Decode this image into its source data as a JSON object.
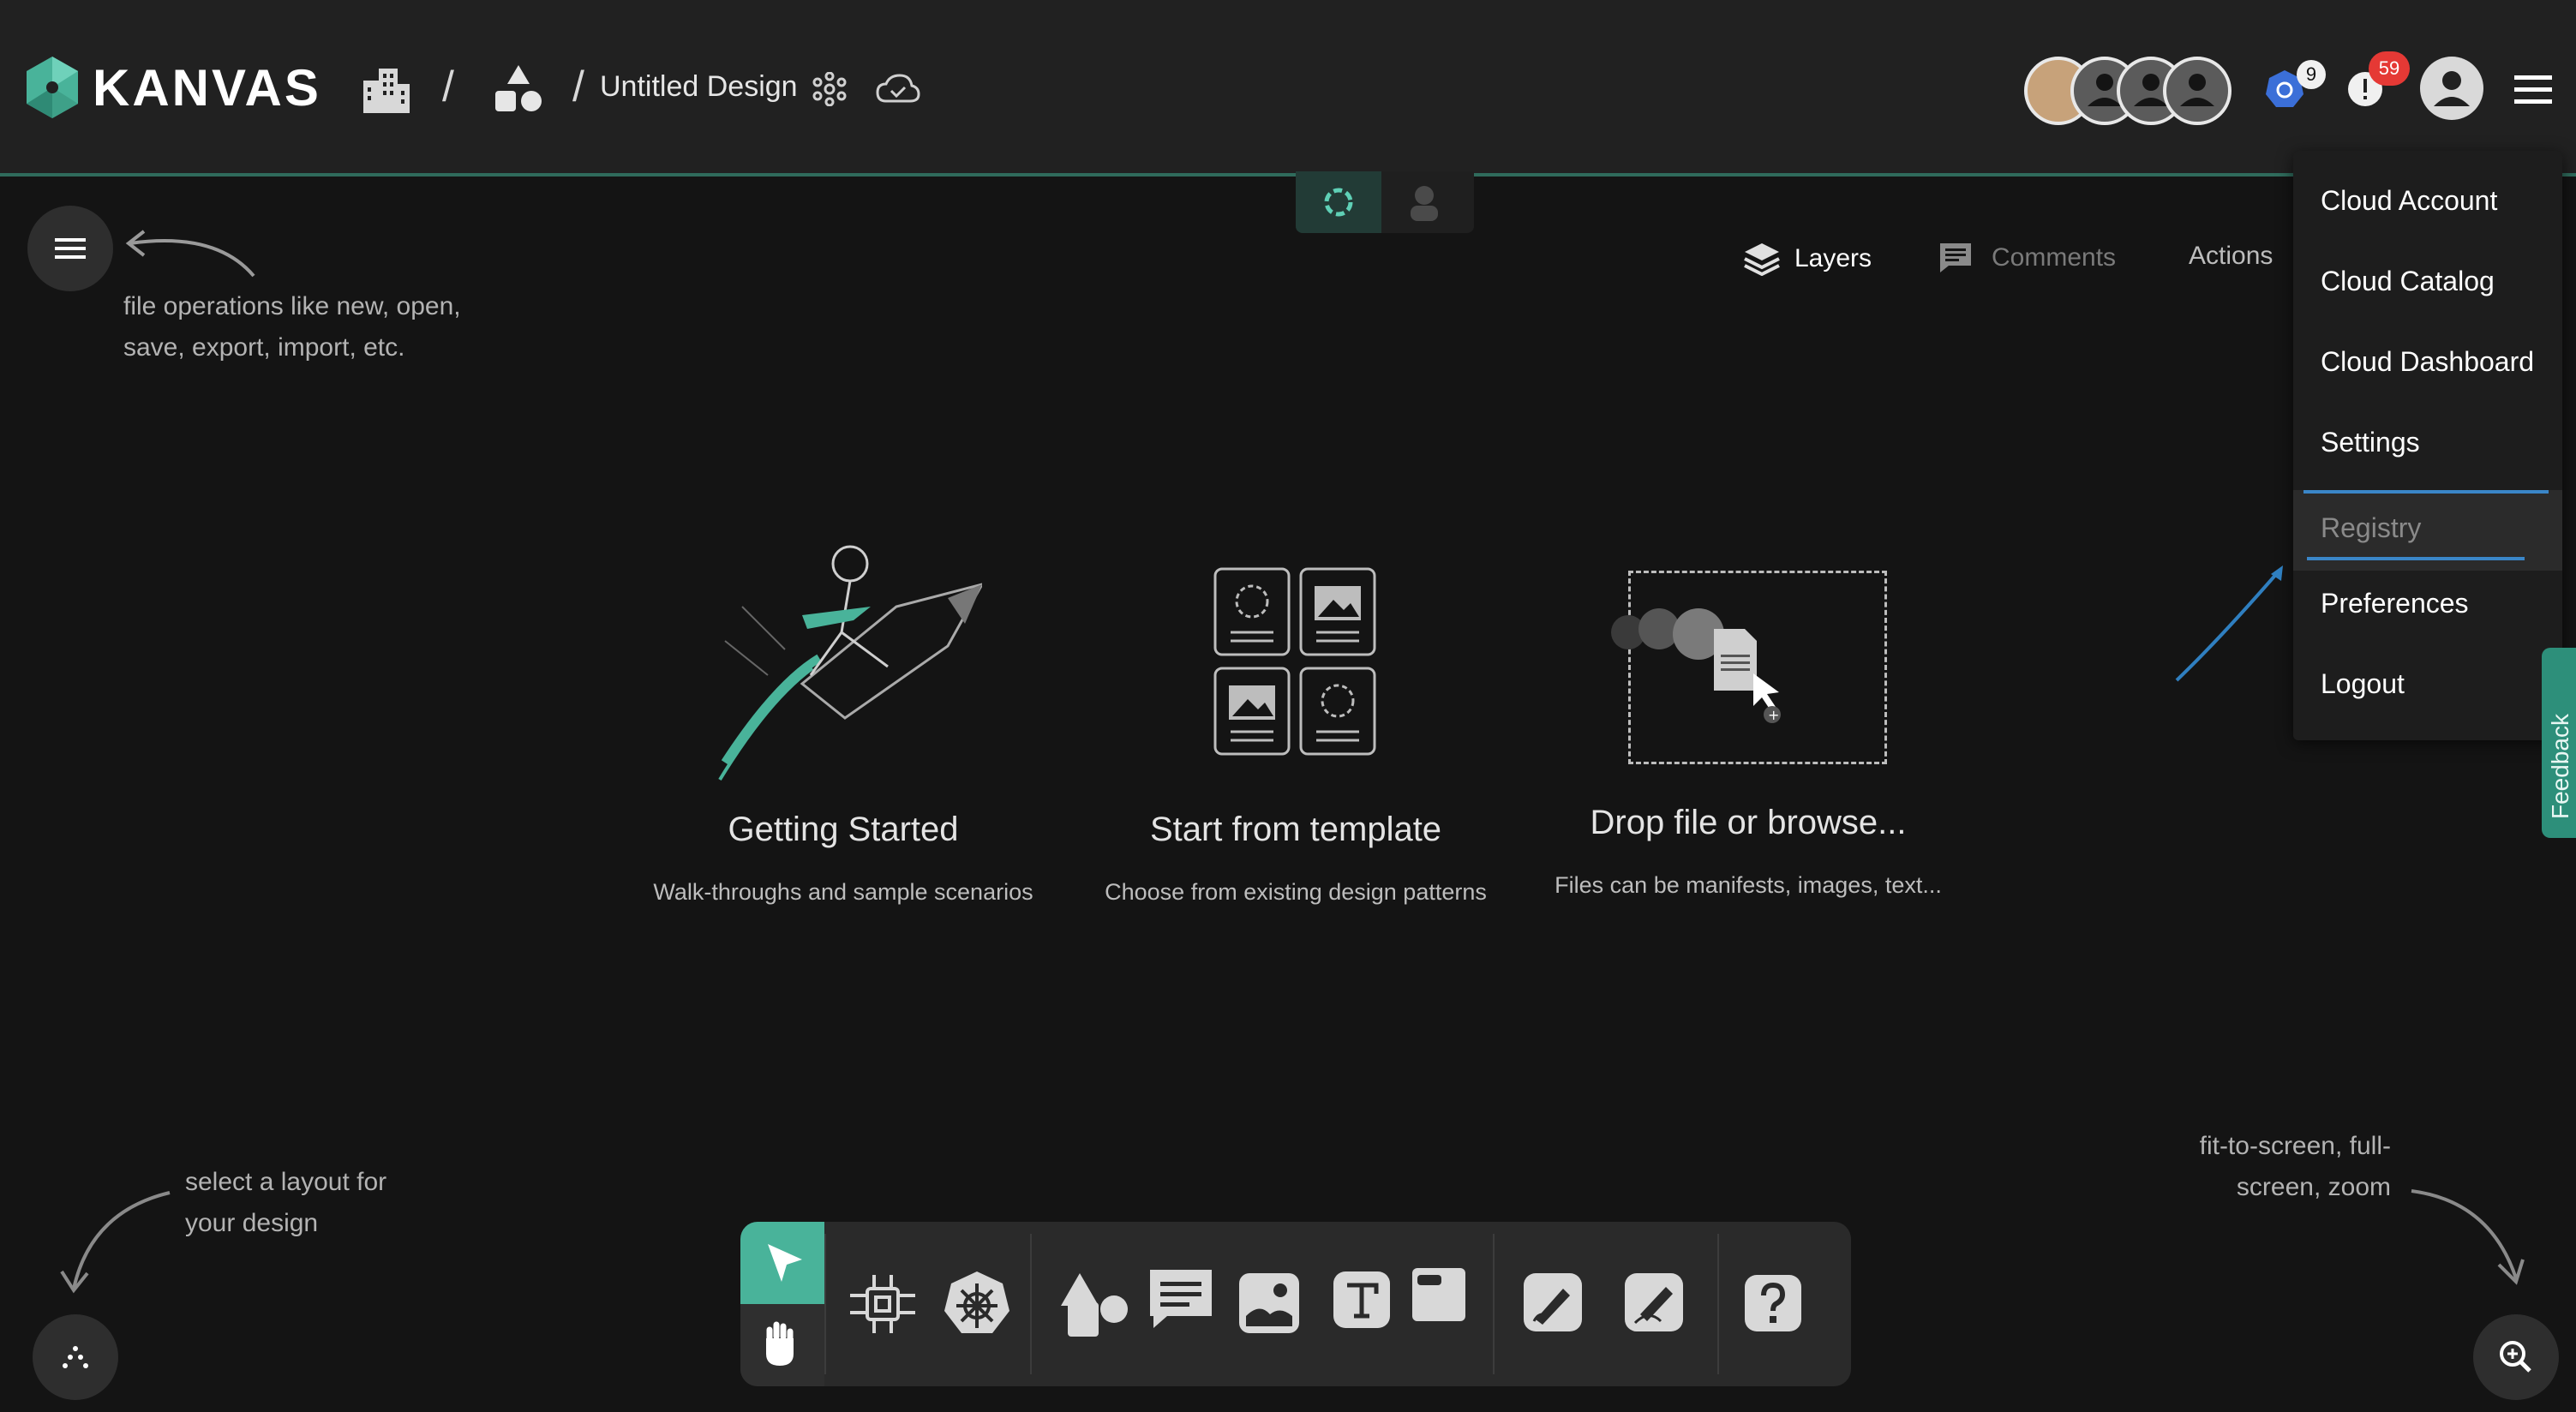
{
  "app": {
    "name": "KANVAS",
    "design_title": "Untitled Design",
    "separator": "/"
  },
  "header": {
    "notifications_kube_count": "9",
    "notifications_alert_count": "59"
  },
  "tabs": {
    "layers": "Layers",
    "comments": "Comments",
    "actions": "Actions"
  },
  "menu": {
    "items": [
      "Cloud Account",
      "Cloud Catalog",
      "Cloud Dashboard",
      "Settings",
      "Registry",
      "Preferences",
      "Logout"
    ],
    "active": "Registry"
  },
  "feedback_label": "Feedback",
  "hints": {
    "file_ops": "file operations like new, open, save, export, import, etc.",
    "layout": "select a layout for your design",
    "zoom": "fit-to-screen, full-screen, zoom"
  },
  "cards": [
    {
      "title": "Getting Started",
      "subtitle": "Walk-throughs and sample scenarios"
    },
    {
      "title": "Start from template",
      "subtitle": "Choose from existing design patterns"
    },
    {
      "title": "Drop file or browse...",
      "subtitle": "Files can be manifests, images, text..."
    }
  ],
  "colors": {
    "accent": "#49b39a",
    "badge_red": "#e53935",
    "kube_blue": "#3b6fd8",
    "header_bg": "#212121",
    "canvas_bg": "#141414"
  },
  "icons": {
    "logo": "kanvas-logo-icon",
    "workspace": "building-icon",
    "shapes": "shapes-icon",
    "topology": "network-icon",
    "cloud": "cloud-sync-icon",
    "menu": "hamburger-icon",
    "help": "question-icon",
    "zoom": "zoom-in-icon"
  }
}
